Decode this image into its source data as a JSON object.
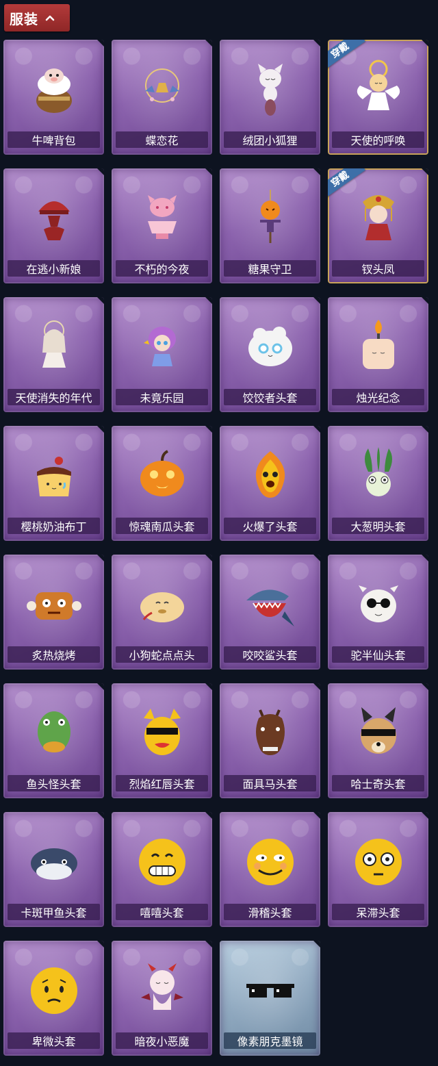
{
  "section": {
    "title": "服装",
    "expanded": true
  },
  "worn_badge": "穿戴",
  "items": [
    {
      "name": "牛啤背包",
      "icon": "cow-beer-backpack-icon",
      "worn": false
    },
    {
      "name": "蝶恋花",
      "icon": "butterfly-flower-icon",
      "worn": false
    },
    {
      "name": "绒团小狐狸",
      "icon": "fluffy-fox-icon",
      "worn": false
    },
    {
      "name": "天使的呼唤",
      "icon": "angel-call-icon",
      "worn": true
    },
    {
      "name": "在逃小新娘",
      "icon": "runaway-bride-icon",
      "worn": false
    },
    {
      "name": "不朽的今夜",
      "icon": "immortal-tonight-icon",
      "worn": false
    },
    {
      "name": "糖果守卫",
      "icon": "candy-guard-icon",
      "worn": false
    },
    {
      "name": "钗头凤",
      "icon": "phoenix-hairpin-icon",
      "worn": true
    },
    {
      "name": "天使消失的年代",
      "icon": "vanished-angel-icon",
      "worn": false
    },
    {
      "name": "未竟乐园",
      "icon": "unfinished-paradise-icon",
      "worn": false
    },
    {
      "name": "饺饺者头套",
      "icon": "dumpling-head-icon",
      "worn": false
    },
    {
      "name": "烛光纪念",
      "icon": "candle-icon",
      "worn": false
    },
    {
      "name": "樱桃奶油布丁",
      "icon": "pudding-icon",
      "worn": false
    },
    {
      "name": "惊魂南瓜头套",
      "icon": "pumpkin-head-icon",
      "worn": false
    },
    {
      "name": "火爆了头套",
      "icon": "fire-head-icon",
      "worn": false
    },
    {
      "name": "大葱明头套",
      "icon": "scallion-head-icon",
      "worn": false
    },
    {
      "name": "炙热烧烤",
      "icon": "bbq-meat-icon",
      "worn": false
    },
    {
      "name": "小狗蛇点点头",
      "icon": "dog-snake-icon",
      "worn": false
    },
    {
      "name": "咬咬鲨头套",
      "icon": "shark-head-icon",
      "worn": false
    },
    {
      "name": "驼半仙头套",
      "icon": "alpaca-head-icon",
      "worn": false
    },
    {
      "name": "鱼头怪头套",
      "icon": "fish-head-icon",
      "worn": false
    },
    {
      "name": "烈焰红唇头套",
      "icon": "red-lips-head-icon",
      "worn": false
    },
    {
      "name": "面具马头套",
      "icon": "horse-head-icon",
      "worn": false
    },
    {
      "name": "哈士奇头套",
      "icon": "husky-head-icon",
      "worn": false
    },
    {
      "name": "卡斑甲鱼头套",
      "icon": "turtle-head-icon",
      "worn": false
    },
    {
      "name": "嘻嘻头套",
      "icon": "grin-emoji-head-icon",
      "worn": false
    },
    {
      "name": "滑稽头套",
      "icon": "funny-emoji-head-icon",
      "worn": false
    },
    {
      "name": "呆滞头套",
      "icon": "dazed-emoji-head-icon",
      "worn": false
    },
    {
      "name": "卑微头套",
      "icon": "humble-emoji-head-icon",
      "worn": false
    },
    {
      "name": "暗夜小恶魔",
      "icon": "little-devil-icon",
      "worn": false
    },
    {
      "name": "像素朋克墨镜",
      "icon": "pixel-sunglasses-icon",
      "worn": false,
      "rarity_bg": "blue"
    }
  ]
}
